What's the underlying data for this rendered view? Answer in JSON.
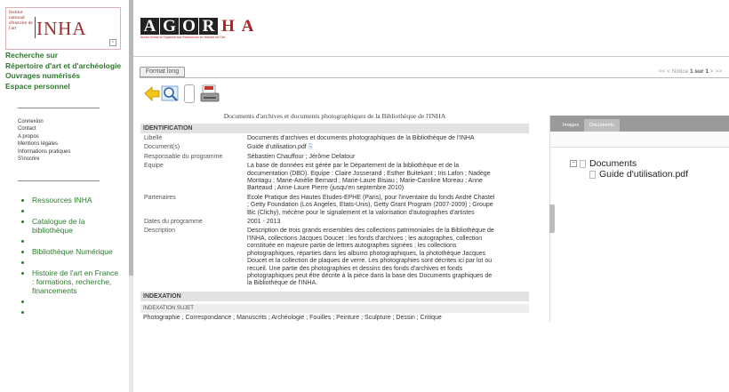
{
  "inha_logo": {
    "small_text": "Institut national d'histoire de l'art",
    "big_text": "INHA"
  },
  "sidebar": {
    "nav": [
      "Recherche sur",
      "Répertoire d'art et d'archéologie",
      "Ouvrages numérisés",
      "Espace personnel"
    ],
    "links": [
      "Connexion",
      "Contact",
      "A propos",
      "Mentions légales",
      "Informations pratiques",
      "S'inscrire"
    ],
    "list": [
      "Ressources INHA",
      "",
      "Catalogue de la bibliothèque",
      "",
      "Bibliothèque Numérique",
      "",
      "Histoire de l'art en France : formations, recherche, financements",
      "",
      ""
    ]
  },
  "agorha": {
    "letters": [
      "A",
      "G",
      "O",
      "R",
      "H",
      "A"
    ],
    "tagline": "Accès Global et Organisé aux Ressources en Histoire de l'Art"
  },
  "toolbar": {
    "tab_label": "Format long",
    "notice_prev": "<< < Notice",
    "notice_pos": "1 sur 1",
    "notice_next": "> >>"
  },
  "record": {
    "title": "Documents d'archives et documents photographiques de la Bibliothèque de l'INHA",
    "identification_header": "IDENTIFICATION",
    "fields": [
      {
        "k": "Libellé",
        "v": "Documents d'archives et documents photographiques de la Bibliothèque de l'INHA"
      },
      {
        "k": "Document(s)",
        "v": "Guide d'utilisation.pdf"
      },
      {
        "k": "Responsable du programme",
        "v": "Sébastien Chauffour ; Jérôme Delatour"
      },
      {
        "k": "Equipe",
        "v": "La base de données est gérée par le Département de la bibliothèque et de la documentation (DBD). Equipe : Claire Josserand ; Esther Buitekant ; Iris Lafon ; Nadège Montagu ; Marie-Amélie Bernard ; Marie-Laure Bisiau ; Marie-Caroline Moreau ; Anne Barteaud ; Anne-Laure Pierre (jusqu'en septembre 2010)"
      },
      {
        "k": "Partenaires",
        "v": "Ecole Pratique des Hautes Etudes-EPHE (Paris), pour l'inventaire du fonds André Chastel ; Getty Foundation (Los Angeles, Etats-Unis), Getty Grant Program (2007-2009) ; Groupe Bic (Clichy), mécène pour le signalement et la valorisation d'autographes d'artistes"
      },
      {
        "k": "Dates du programme",
        "v": "2001 - 2013"
      },
      {
        "k": "Description",
        "v": "Description de trois grands ensembles des collections patrimoniales de la Bibliothèque de l'INHA, collections Jacques Doucet : les fonds d'archives ; les autographes, collection constituée en majeure partie de lettres autographes signées ; les collections photographiques, réparties dans les albums photographiques, la photothèque Jacques Doucet et la collection de plaques de verre. Les photographies sont décrites ici par lot ou recueil. Une partie des photographies et dessins des fonds d'archives et fonds photographiques peut être décrite à la pièce dans la base des Documents graphiques de la Bibliothèque de l'INHA."
      }
    ],
    "indexation_header": "INDEXATION",
    "indexation_sub": "INDEXATION SUJET",
    "indexation_text": "Photographie ; Correspondance ; Manuscrits ; Archéologie ; Fouilles ; Peinture ; Sculpture ; Dessin ; Critique"
  },
  "panel": {
    "tab_images": "Images",
    "tab_documents": "Documents",
    "tree_root": "Documents",
    "tree_child": "Guide d'utilisation.pdf"
  },
  "colors": {
    "nav_green": "#2b7a2b",
    "agorha_red": "#b22222",
    "inha_red": "#9b2d2d"
  }
}
